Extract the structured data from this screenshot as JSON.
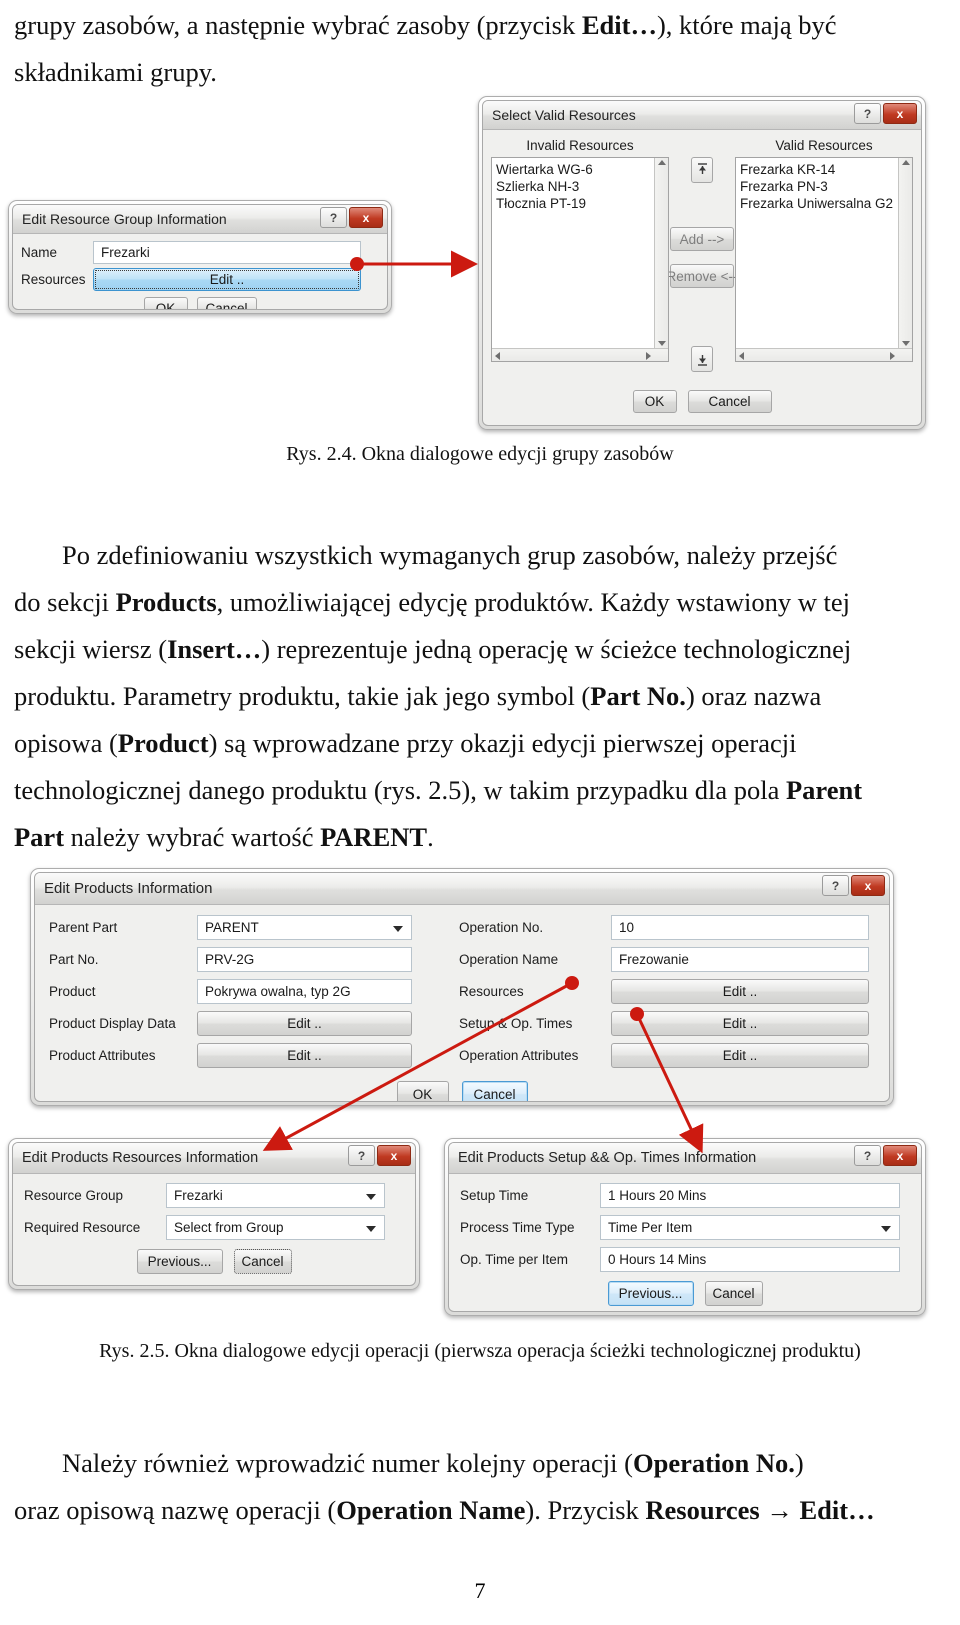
{
  "document": {
    "page_number": "7",
    "paragraph_top": "grupy zasobów, a następnie wybrać zasoby (przycisk Edit…), które mają być składnikami grupy.",
    "paragraph_top_parts": {
      "a": "grupy zasobów, a następnie wybrać zasoby (przycisk ",
      "b1": "Edit…",
      "c": "), które mają być",
      "line2": "składnikami grupy."
    },
    "figure_caption_24": "Rys. 2.4. Okna dialogowe edycji grupy zasobów",
    "figure_caption_25": "Rys. 2.5. Okna dialogowe edycji operacji (pierwsza operacja ścieżki technologicznej produktu)",
    "paragraph_middle": {
      "l1_a": "Po zdefiniowaniu wszystkich wymaganych grup zasobów, należy przejść",
      "l2_a": "do sekcji ",
      "l2_b": "Products",
      "l2_c": ", umożliwiającej edycję produktów. Każdy wstawiony w tej",
      "l3_a": "sekcji wiersz (",
      "l3_b": "Insert…",
      "l3_c": ") reprezentuje jedną operację w ścieżce technologicznej",
      "l4_a": "produktu. Parametry produktu, takie jak jego symbol (",
      "l4_b": "Part No.",
      "l4_c": ") oraz nazwa",
      "l5_a": "opisowa (",
      "l5_b": "Product",
      "l5_c": ") są wprowadzane przy okazji edycji pierwszej operacji",
      "l6_a": "technologicznej danego produktu (rys. 2.5), w takim przypadku dla pola ",
      "l6_b": "Parent",
      "l7_a": "Part",
      "l7_b": " należy wybrać wartość ",
      "l7_c": "PARENT",
      "l7_d": "."
    },
    "paragraph_bottom": {
      "l1_a": "Należy również wprowadzić numer kolejny operacji (",
      "l1_b": "Operation No.",
      "l1_c": ")",
      "l2_a": "oraz opisową nazwę operacji (",
      "l2_b": "Operation Name",
      "l2_c": "). Przycisk ",
      "l2_d": "Resources",
      "l2_e": " → ",
      "l2_f": "Edit…"
    }
  },
  "colors": {
    "accent_red": "#cc1a10",
    "close_red": "#c03a22",
    "dialog_face": "#f0f0ee",
    "field_white": "#ffffff",
    "focus_blue": "#4a9ad4"
  },
  "dialog_edit_resource_group": {
    "title": "Edit Resource Group Information",
    "help_label": "?",
    "close_label": "x",
    "fields": [
      {
        "label": "Name",
        "value": "Frezarki"
      },
      {
        "label": "Resources",
        "value": "Edit .."
      }
    ],
    "buttons": {
      "ok": "OK",
      "cancel": "Cancel"
    }
  },
  "dialog_select_valid_resources": {
    "title": "Select Valid Resources",
    "help_label": "?",
    "close_label": "x",
    "left_header": "Invalid Resources",
    "right_header": "Valid Resources",
    "invalid_resources": [
      "Wiertarka WG-6",
      "Szlierka NH-3",
      "Tłocznia PT-19"
    ],
    "valid_resources": [
      "Frezarka KR-14",
      "Frezarka PN-3",
      "Frezarka Uniwersalna G2"
    ],
    "add_label": "Add -->",
    "remove_label": "Remove <--",
    "move_up_icon": "arrow-up-icon",
    "move_down_icon": "arrow-down-icon",
    "buttons": {
      "ok": "OK",
      "cancel": "Cancel"
    }
  },
  "dialog_edit_products": {
    "title": "Edit Products Information",
    "help_label": "?",
    "close_label": "x",
    "left_fields": [
      {
        "label": "Parent Part",
        "value": "PARENT",
        "type": "combo"
      },
      {
        "label": "Part No.",
        "value": "PRV-2G",
        "type": "text"
      },
      {
        "label": "Product",
        "value": "Pokrywa owalna, typ 2G",
        "type": "text"
      },
      {
        "label": "Product Display Data",
        "value": "Edit ..",
        "type": "button"
      },
      {
        "label": "Product Attributes",
        "value": "Edit ..",
        "type": "button"
      }
    ],
    "right_fields": [
      {
        "label": "Operation No.",
        "value": "10",
        "type": "text"
      },
      {
        "label": "Operation Name",
        "value": "Frezowanie",
        "type": "text"
      },
      {
        "label": "Resources",
        "value": "Edit ..",
        "type": "button"
      },
      {
        "label": "Setup & Op. Times",
        "value": "Edit ..",
        "type": "button"
      },
      {
        "label": "Operation Attributes",
        "value": "Edit ..",
        "type": "button"
      }
    ],
    "buttons": {
      "ok": "OK",
      "cancel": "Cancel"
    }
  },
  "dialog_products_resources": {
    "title": "Edit Products Resources  Information",
    "help_label": "?",
    "close_label": "x",
    "fields": [
      {
        "label": "Resource Group",
        "value": "Frezarki",
        "type": "combo"
      },
      {
        "label": "Required Resource",
        "value": "Select from Group",
        "type": "combo"
      }
    ],
    "buttons": {
      "previous": "Previous...",
      "cancel": "Cancel"
    }
  },
  "dialog_setup_op_times": {
    "title": "Edit Products Setup && Op. Times  Information",
    "help_label": "?",
    "close_label": "x",
    "fields": [
      {
        "label": "Setup Time",
        "value": "1 Hours 20 Mins",
        "type": "text"
      },
      {
        "label": "Process Time Type",
        "value": "Time Per Item",
        "type": "combo"
      },
      {
        "label": "Op. Time per Item",
        "value": "0 Hours 14 Mins",
        "type": "text"
      }
    ],
    "buttons": {
      "previous": "Previous...",
      "cancel": "Cancel"
    }
  }
}
